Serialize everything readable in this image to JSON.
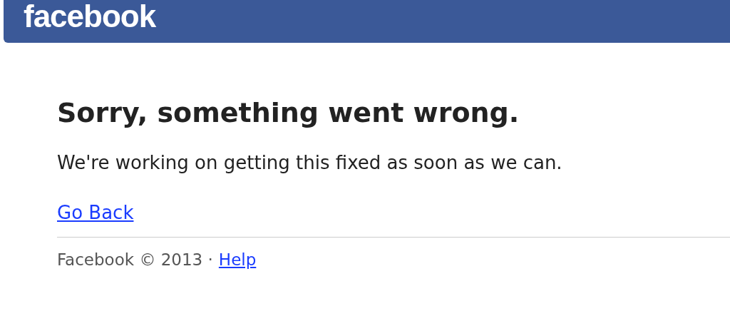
{
  "header": {
    "logo": "facebook"
  },
  "error": {
    "title": "Sorry, something went wrong.",
    "message": "We're working on getting this fixed as soon as we can.",
    "link": "Go Back"
  },
  "footer": {
    "text": "Facebook © 2013 ·",
    "link": "Help"
  }
}
